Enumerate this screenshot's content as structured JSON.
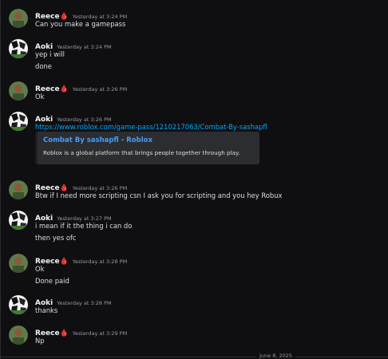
{
  "messages": [
    {
      "author": "Reece🩸",
      "time": "Yesterday at 3:24 PM",
      "lines": [
        "Can you make a gamepass"
      ]
    },
    {
      "author": "Aoki",
      "time": "Yesterday at 3:24 PM",
      "lines": [
        "yep i will",
        "done"
      ]
    },
    {
      "author": "Reece🩸",
      "time": "Yesterday at 3:26 PM",
      "lines": [
        "Ok"
      ]
    },
    {
      "author": "Aoki",
      "time": "Yesterday at 3:26 PM",
      "link": "https://www.roblox.com/game-pass/1210217063/Combat-By-sashapfl",
      "embed": {
        "title": "Combat By sashapfl - Roblox",
        "description": "Roblox is a global platform that brings people together through play."
      }
    },
    {
      "author": "Reece🩸",
      "time": "Yesterday at 3:26 PM",
      "lines": [
        "Btw if I need more scripting csn I ask you for scripting and you hey Robux"
      ]
    },
    {
      "author": "Aoki",
      "time": "Yesterday at 3:27 PM",
      "lines": [
        "i mean if it the thing i can do",
        "then yes ofc"
      ]
    },
    {
      "author": "Reece🩸",
      "time": "Yesterday at 3:28 PM",
      "lines": [
        "Ok",
        "Done paid"
      ]
    },
    {
      "author": "Aoki",
      "time": "Yesterday at 3:28 PM",
      "lines": [
        "thanks"
      ]
    },
    {
      "author": "Reece🩸",
      "time": "Yesterday at 3:29 PM",
      "lines": [
        "Np"
      ]
    }
  ],
  "date_divider": "June 8, 2025",
  "avatars": {
    "reece": "reece-avatar",
    "aoki": "aoki-avatar"
  },
  "colors": {
    "background": "#0f0f12",
    "link": "#00a8fc",
    "embed_title": "#4a9cf5",
    "embed_bg": "#2b2d31"
  }
}
